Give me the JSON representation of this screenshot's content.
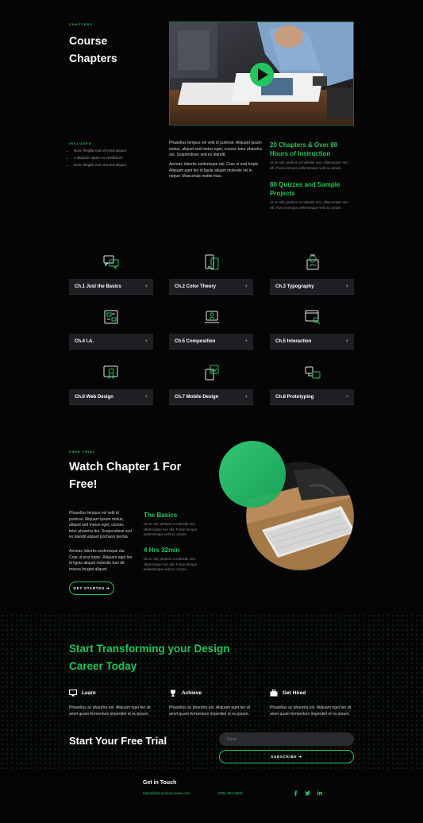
{
  "chapters_section": {
    "eyebrow": "CHAPTERS",
    "title_line1": "Course",
    "title_line2": "Chapters"
  },
  "included": {
    "eyebrow": "INCLUDED",
    "items": [
      "Nunc fringilla erat ut lectus aliquet",
      "A aliquam sapien ex vestibulum",
      "Nunc fringilla erat ut lectus aliquet"
    ]
  },
  "intro": {
    "para1": "Phasellus tempus vel velit id pulvinar. Aliquam ipsum metus, aliquet sed metus eget, consec tetur pharetra dui. Suspendisse sed ex blandit.",
    "para2": "Aenean lobortis scelerisque dui. Cras ut erat turpis. Aliquam eget leo id ligula aliquet molestie vel in neque. Maecenas mattis mau."
  },
  "stats": [
    {
      "title": "20 Chapters & Over 80 Hours of Instruction",
      "text": "Ut ex nisl, pretium a molestie non, ullamcorper nec elit. Fusce tempor pellentesque velit ac ornare."
    },
    {
      "title": "80 Quizzes and Sample Projects",
      "text": "Ut ex nisl, pretium a molestie non, ullamcorper nec elit. Fusce tempor pellentesque velit ac ornare."
    }
  ],
  "chapters": [
    {
      "label": "Ch.1 Just the Basics",
      "icon": "chat-bubbles-icon"
    },
    {
      "label": "Ch.2 Color Theory",
      "icon": "mobile-devices-icon"
    },
    {
      "label": "Ch.3 Typography",
      "icon": "badge-person-icon"
    },
    {
      "label": "Ch.4 I.A.",
      "icon": "sitemap-document-icon"
    },
    {
      "label": "Ch.5 Composition",
      "icon": "laptop-user-icon"
    },
    {
      "label": "Ch.5 Interaction",
      "icon": "browser-search-icon"
    },
    {
      "label": "Ch.6 Web Design",
      "icon": "monitor-award-icon"
    },
    {
      "label": "Ch.7 Mobile Design",
      "icon": "mobile-image-icon"
    },
    {
      "label": "Ch.8 Prototyping",
      "icon": "screens-flow-icon"
    }
  ],
  "plus_symbol": "+",
  "free_trial": {
    "eyebrow": "FREE TRIAL",
    "title_line1": "Watch Chapter 1 For",
    "title_line2": "Free!",
    "para1": "Phasellus tempus vel velit id pulvinar. Aliquam ipsum metus, aliquet sed metus eget, consec tetur pharetra dui. Suspendisse sed ex blandit aliquet pochaon pernta.",
    "para2": "Aenean lobortis scelerisque dui. Cras ut erat turpis. Aliquam eget leo id ligula aliquet molestie ban dit massa feugiat aliquet.",
    "basics_title": "The Basics",
    "basics_text": "Ut ex nisl, pretium a molestie non, ullamcorper nec elit. Fusce tempor pellentesque velit ac ornare.",
    "hours_title": "4 Hrs 32min",
    "hours_text": "Ut ex nisl, pretium a molestie non, ullamcorper nec elit. Fusce tempor pellentesque velit ac ornare.",
    "button": "GET STARTED ➔"
  },
  "transform": {
    "title_line1": "Start Transforming your Design",
    "title_line2": "Career Today",
    "features": [
      {
        "title": "Learn",
        "icon": "monitor-icon",
        "text": "Phasellus ac pharetra est. Aliquam eget leo sit amet quam fermentum imperdiet et eu ipsum."
      },
      {
        "title": "Achieve",
        "icon": "trophy-icon",
        "text": "Phasellus ac pharetra est. Aliquam eget leo sit amet quam fermentum imperdiet et eu ipsum."
      },
      {
        "title": "Get Hired",
        "icon": "briefcase-icon",
        "text": "Phasellus ac pharetra est. Aliquam eget leo sit amet quam fermentum imperdiet et eu ipsum."
      }
    ]
  },
  "trial_form": {
    "title": "Start Your Free Trial",
    "email_placeholder": "Email",
    "subscribe": "SUBSCRIBE ➔"
  },
  "footer": {
    "title": "Get in Touch",
    "email": "hello@diviuonlinecourse.com",
    "phone": "(255) 352-6258",
    "social": [
      "facebook-icon",
      "twitter-icon",
      "linkedin-icon"
    ]
  },
  "colors": {
    "accent": "#22c55e",
    "background": "#050505",
    "card": "#1e1f22"
  }
}
